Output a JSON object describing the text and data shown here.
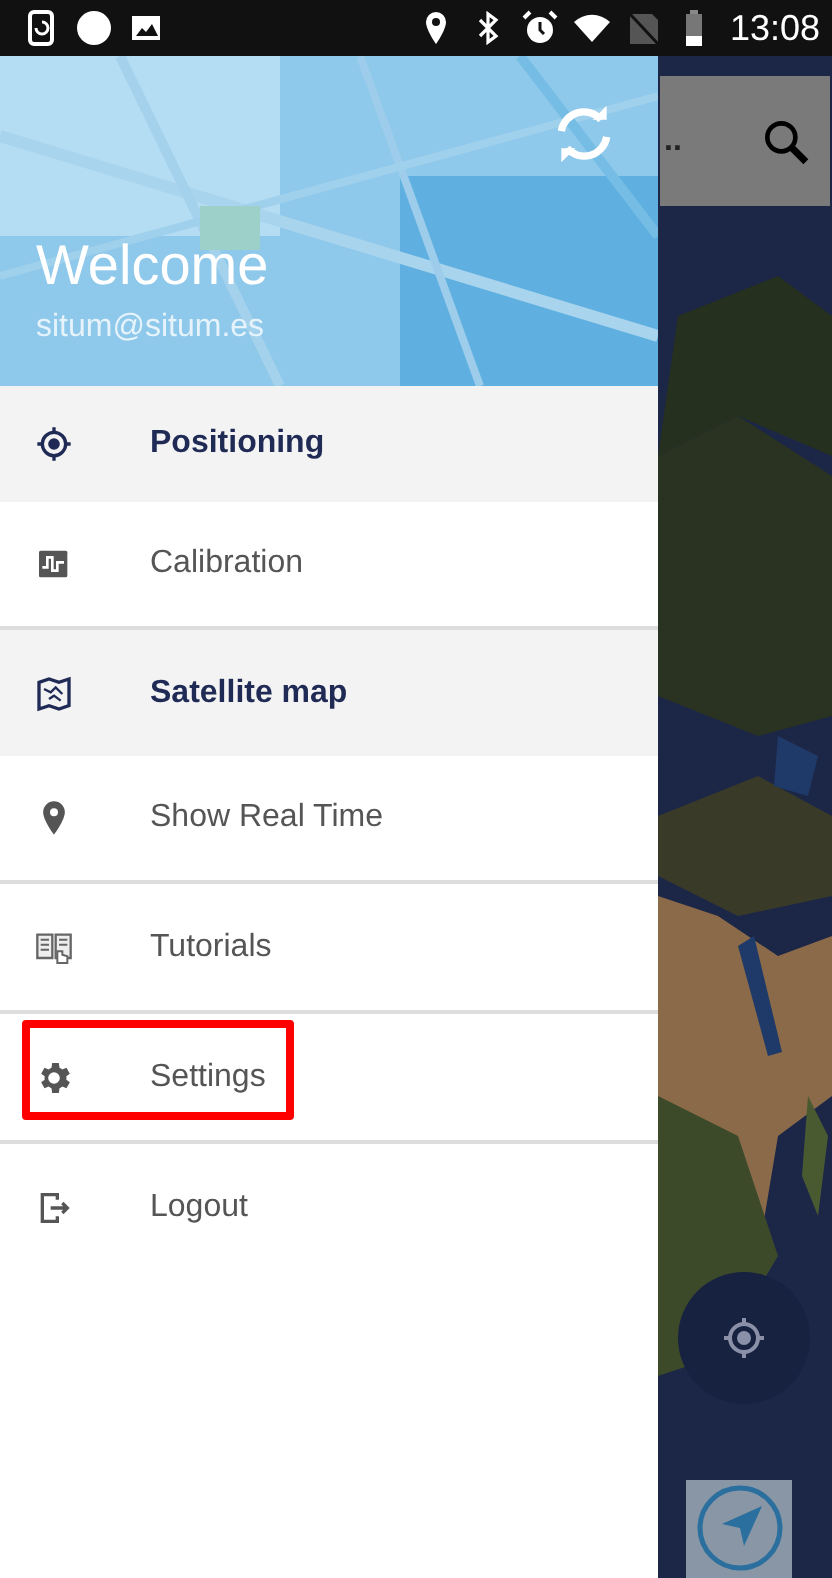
{
  "status_bar": {
    "time": "13:08"
  },
  "drawer": {
    "header": {
      "title": "Welcome",
      "email": "situm@situm.es"
    },
    "items": [
      {
        "label": "Positioning",
        "kind": "target",
        "selected": true,
        "divider_after": false,
        "annotated": false
      },
      {
        "label": "Calibration",
        "kind": "signal",
        "selected": false,
        "divider_after": true,
        "annotated": false
      },
      {
        "label": "Satellite map",
        "kind": "map",
        "selected": true,
        "divider_after": false,
        "annotated": false
      },
      {
        "label": "Show Real Time",
        "kind": "pin",
        "selected": false,
        "divider_after": true,
        "annotated": false
      },
      {
        "label": "Tutorials",
        "kind": "book",
        "selected": false,
        "divider_after": true,
        "annotated": false
      },
      {
        "label": "Settings",
        "kind": "gear",
        "selected": false,
        "divider_after": true,
        "annotated": true
      },
      {
        "label": "Logout",
        "kind": "logout",
        "selected": false,
        "divider_after": false,
        "annotated": false
      }
    ]
  },
  "map": {
    "search": {
      "placeholder": ".."
    }
  }
}
